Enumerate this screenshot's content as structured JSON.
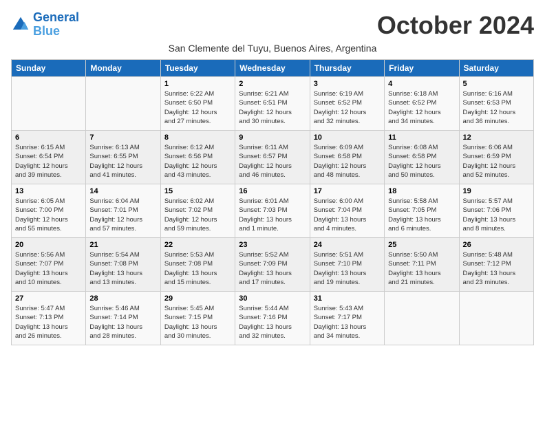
{
  "logo": {
    "line1": "General",
    "line2": "Blue"
  },
  "title": "October 2024",
  "subtitle": "San Clemente del Tuyu, Buenos Aires, Argentina",
  "weekdays": [
    "Sunday",
    "Monday",
    "Tuesday",
    "Wednesday",
    "Thursday",
    "Friday",
    "Saturday"
  ],
  "weeks": [
    [
      {
        "day": "",
        "info": ""
      },
      {
        "day": "",
        "info": ""
      },
      {
        "day": "1",
        "info": "Sunrise: 6:22 AM\nSunset: 6:50 PM\nDaylight: 12 hours\nand 27 minutes."
      },
      {
        "day": "2",
        "info": "Sunrise: 6:21 AM\nSunset: 6:51 PM\nDaylight: 12 hours\nand 30 minutes."
      },
      {
        "day": "3",
        "info": "Sunrise: 6:19 AM\nSunset: 6:52 PM\nDaylight: 12 hours\nand 32 minutes."
      },
      {
        "day": "4",
        "info": "Sunrise: 6:18 AM\nSunset: 6:52 PM\nDaylight: 12 hours\nand 34 minutes."
      },
      {
        "day": "5",
        "info": "Sunrise: 6:16 AM\nSunset: 6:53 PM\nDaylight: 12 hours\nand 36 minutes."
      }
    ],
    [
      {
        "day": "6",
        "info": "Sunrise: 6:15 AM\nSunset: 6:54 PM\nDaylight: 12 hours\nand 39 minutes."
      },
      {
        "day": "7",
        "info": "Sunrise: 6:13 AM\nSunset: 6:55 PM\nDaylight: 12 hours\nand 41 minutes."
      },
      {
        "day": "8",
        "info": "Sunrise: 6:12 AM\nSunset: 6:56 PM\nDaylight: 12 hours\nand 43 minutes."
      },
      {
        "day": "9",
        "info": "Sunrise: 6:11 AM\nSunset: 6:57 PM\nDaylight: 12 hours\nand 46 minutes."
      },
      {
        "day": "10",
        "info": "Sunrise: 6:09 AM\nSunset: 6:58 PM\nDaylight: 12 hours\nand 48 minutes."
      },
      {
        "day": "11",
        "info": "Sunrise: 6:08 AM\nSunset: 6:58 PM\nDaylight: 12 hours\nand 50 minutes."
      },
      {
        "day": "12",
        "info": "Sunrise: 6:06 AM\nSunset: 6:59 PM\nDaylight: 12 hours\nand 52 minutes."
      }
    ],
    [
      {
        "day": "13",
        "info": "Sunrise: 6:05 AM\nSunset: 7:00 PM\nDaylight: 12 hours\nand 55 minutes."
      },
      {
        "day": "14",
        "info": "Sunrise: 6:04 AM\nSunset: 7:01 PM\nDaylight: 12 hours\nand 57 minutes."
      },
      {
        "day": "15",
        "info": "Sunrise: 6:02 AM\nSunset: 7:02 PM\nDaylight: 12 hours\nand 59 minutes."
      },
      {
        "day": "16",
        "info": "Sunrise: 6:01 AM\nSunset: 7:03 PM\nDaylight: 13 hours\nand 1 minute."
      },
      {
        "day": "17",
        "info": "Sunrise: 6:00 AM\nSunset: 7:04 PM\nDaylight: 13 hours\nand 4 minutes."
      },
      {
        "day": "18",
        "info": "Sunrise: 5:58 AM\nSunset: 7:05 PM\nDaylight: 13 hours\nand 6 minutes."
      },
      {
        "day": "19",
        "info": "Sunrise: 5:57 AM\nSunset: 7:06 PM\nDaylight: 13 hours\nand 8 minutes."
      }
    ],
    [
      {
        "day": "20",
        "info": "Sunrise: 5:56 AM\nSunset: 7:07 PM\nDaylight: 13 hours\nand 10 minutes."
      },
      {
        "day": "21",
        "info": "Sunrise: 5:54 AM\nSunset: 7:08 PM\nDaylight: 13 hours\nand 13 minutes."
      },
      {
        "day": "22",
        "info": "Sunrise: 5:53 AM\nSunset: 7:08 PM\nDaylight: 13 hours\nand 15 minutes."
      },
      {
        "day": "23",
        "info": "Sunrise: 5:52 AM\nSunset: 7:09 PM\nDaylight: 13 hours\nand 17 minutes."
      },
      {
        "day": "24",
        "info": "Sunrise: 5:51 AM\nSunset: 7:10 PM\nDaylight: 13 hours\nand 19 minutes."
      },
      {
        "day": "25",
        "info": "Sunrise: 5:50 AM\nSunset: 7:11 PM\nDaylight: 13 hours\nand 21 minutes."
      },
      {
        "day": "26",
        "info": "Sunrise: 5:48 AM\nSunset: 7:12 PM\nDaylight: 13 hours\nand 23 minutes."
      }
    ],
    [
      {
        "day": "27",
        "info": "Sunrise: 5:47 AM\nSunset: 7:13 PM\nDaylight: 13 hours\nand 26 minutes."
      },
      {
        "day": "28",
        "info": "Sunrise: 5:46 AM\nSunset: 7:14 PM\nDaylight: 13 hours\nand 28 minutes."
      },
      {
        "day": "29",
        "info": "Sunrise: 5:45 AM\nSunset: 7:15 PM\nDaylight: 13 hours\nand 30 minutes."
      },
      {
        "day": "30",
        "info": "Sunrise: 5:44 AM\nSunset: 7:16 PM\nDaylight: 13 hours\nand 32 minutes."
      },
      {
        "day": "31",
        "info": "Sunrise: 5:43 AM\nSunset: 7:17 PM\nDaylight: 13 hours\nand 34 minutes."
      },
      {
        "day": "",
        "info": ""
      },
      {
        "day": "",
        "info": ""
      }
    ]
  ]
}
